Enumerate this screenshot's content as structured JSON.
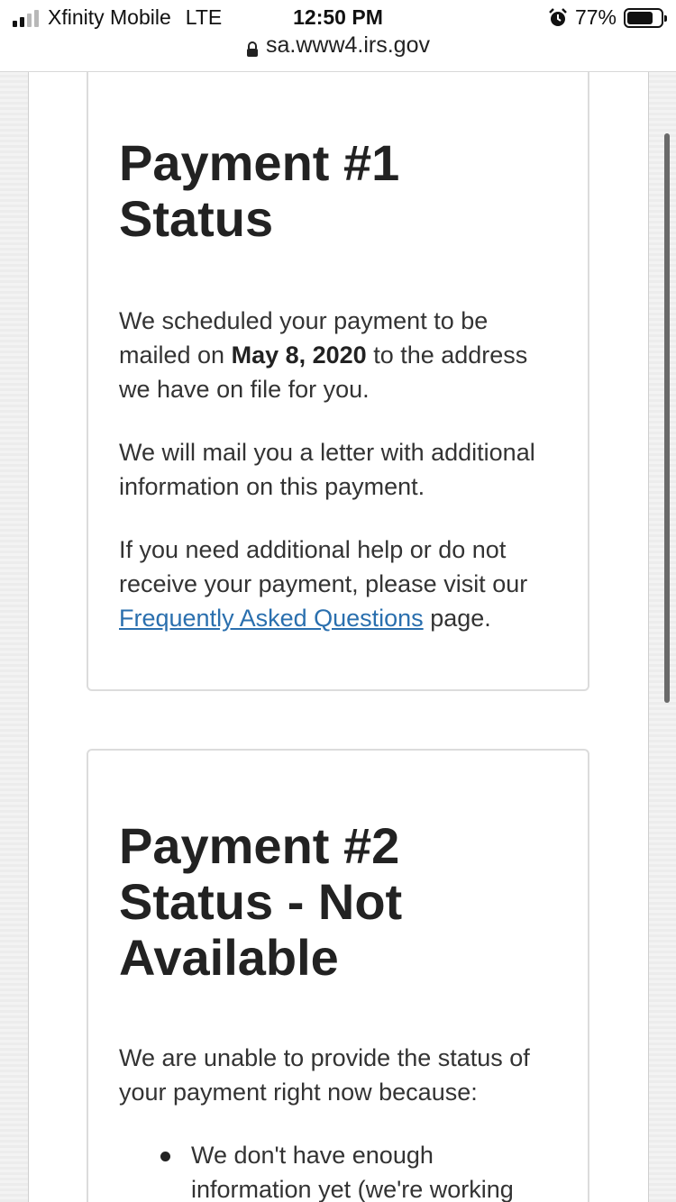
{
  "status_bar": {
    "carrier": "Xfinity Mobile",
    "network": "LTE",
    "time": "12:50 PM",
    "battery_percent": "77%",
    "battery_level": 0.77,
    "signal_bars_active": 2
  },
  "url_bar": {
    "domain": "sa.www4.irs.gov"
  },
  "payment1": {
    "title": "Payment #1 Status",
    "p1_before": "We scheduled your payment to be mailed on ",
    "p1_date": "May 8, 2020",
    "p1_after": " to the address we have on file for you.",
    "p2": "We will mail you a letter with additional information on this payment.",
    "p3_before": "If you need additional help or do not receive your payment, please visit our ",
    "p3_link": "Frequently Asked Questions",
    "p3_after": " page."
  },
  "payment2": {
    "title": "Payment #2 Status - Not Available",
    "p1": "We are unable to provide the status of your payment right now because:",
    "bullets": [
      "We don't have enough information yet (we're working"
    ]
  },
  "colors": {
    "link": "#2a6fae",
    "heading": "#222222",
    "body_text": "#333333"
  }
}
